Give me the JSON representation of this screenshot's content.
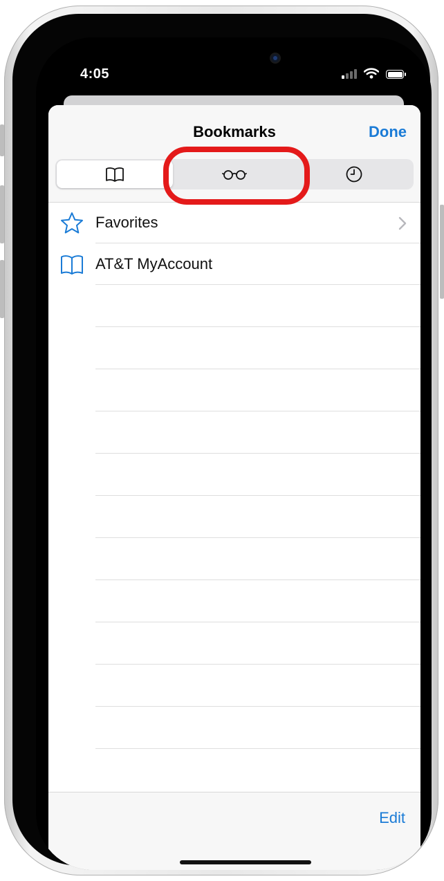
{
  "status_bar": {
    "time": "4:05"
  },
  "sheet": {
    "title": "Bookmarks",
    "done_label": "Done",
    "tabs": [
      {
        "icon": "book-icon",
        "selected": true
      },
      {
        "icon": "glasses-icon",
        "selected": false,
        "highlighted": true
      },
      {
        "icon": "clock-icon",
        "selected": false
      }
    ],
    "items": [
      {
        "icon": "star-icon",
        "label": "Favorites",
        "has_chevron": true
      },
      {
        "icon": "book-icon",
        "label": "AT&T MyAccount",
        "has_chevron": false
      }
    ],
    "edit_label": "Edit"
  },
  "colors": {
    "accent": "#1a7bd6",
    "highlight_ring": "#e41a1a"
  }
}
